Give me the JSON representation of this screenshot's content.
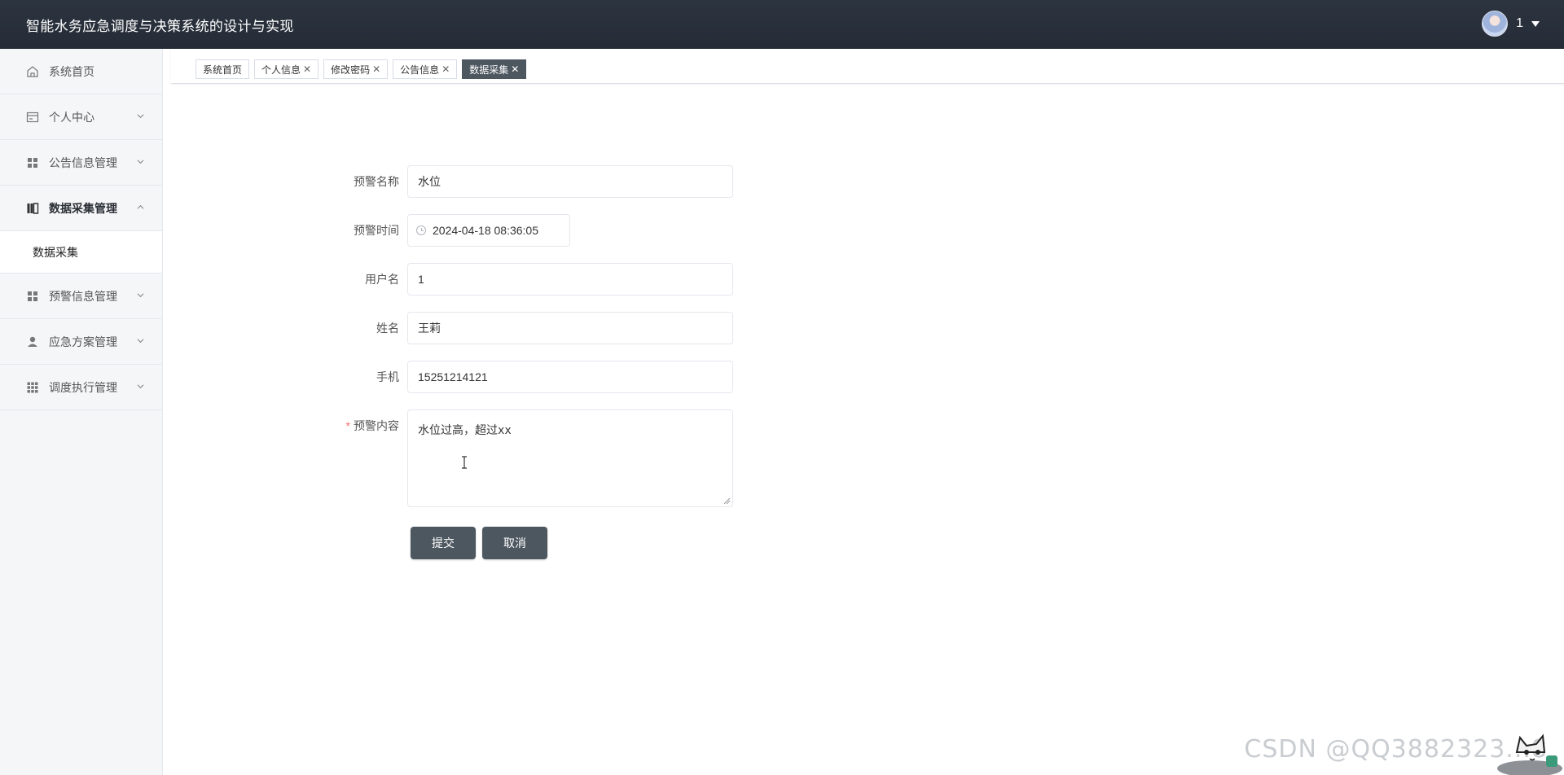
{
  "header": {
    "title": "智能水务应急调度与决策系统的设计与实现",
    "user_name": "1"
  },
  "sidebar": {
    "items": [
      {
        "label": "系统首页",
        "icon": "home-icon"
      },
      {
        "label": "个人中心",
        "icon": "card-icon"
      },
      {
        "label": "公告信息管理",
        "icon": "grid-icon"
      },
      {
        "label": "数据采集管理",
        "icon": "book-icon",
        "expanded": true
      },
      {
        "label": "预警信息管理",
        "icon": "grid-icon"
      },
      {
        "label": "应急方案管理",
        "icon": "user-icon"
      },
      {
        "label": "调度执行管理",
        "icon": "grid9-icon"
      }
    ],
    "sub_items": [
      {
        "label": "数据采集"
      }
    ]
  },
  "tabs": [
    {
      "label": "系统首页",
      "closable": false
    },
    {
      "label": "个人信息",
      "closable": true
    },
    {
      "label": "修改密码",
      "closable": true
    },
    {
      "label": "公告信息",
      "closable": true
    },
    {
      "label": "数据采集",
      "closable": true,
      "active": true
    }
  ],
  "form": {
    "warning_name": {
      "label": "预警名称",
      "value": "水位"
    },
    "warning_time": {
      "label": "预警时间",
      "value": "2024-04-18 08:36:05"
    },
    "username": {
      "label": "用户名",
      "value": "1"
    },
    "name": {
      "label": "姓名",
      "value": "王莉"
    },
    "phone": {
      "label": "手机",
      "value": "15251214121"
    },
    "content": {
      "label": "预警内容",
      "required_mark": "*",
      "value": "水位过高，超过xx"
    },
    "submit_label": "提交",
    "cancel_label": "取消"
  },
  "watermark": "CSDN @QQ3882323...8",
  "colors": {
    "header_bg": "#2c3440",
    "accent_button": "#4d5760",
    "sidebar_bg": "#f5f6f8",
    "required": "#f56c6c"
  }
}
